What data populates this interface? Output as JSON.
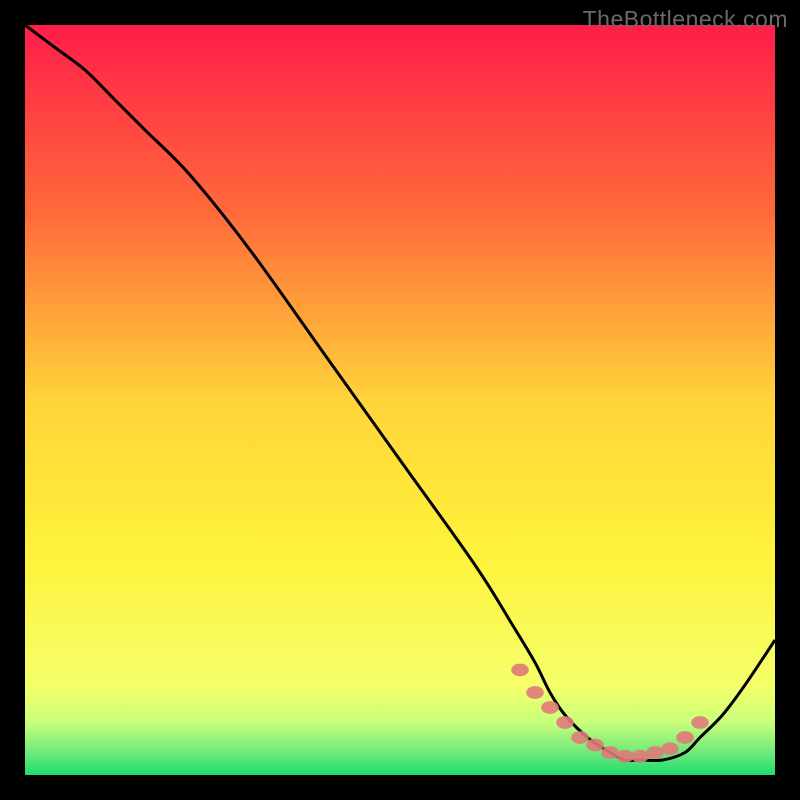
{
  "watermark": "TheBottleneck.com",
  "chart_data": {
    "type": "line",
    "title": "",
    "xlabel": "",
    "ylabel": "",
    "xlim": [
      0,
      100
    ],
    "ylim": [
      0,
      100
    ],
    "background_gradient": {
      "stops": [
        {
          "offset": 0,
          "color": "#ff1d4a"
        },
        {
          "offset": 0.25,
          "color": "#ff6a3a"
        },
        {
          "offset": 0.5,
          "color": "#ffd33a"
        },
        {
          "offset": 0.7,
          "color": "#fff23a"
        },
        {
          "offset": 0.88,
          "color": "#f5ff6a"
        },
        {
          "offset": 0.93,
          "color": "#c8ff7a"
        },
        {
          "offset": 0.97,
          "color": "#6fe97a"
        },
        {
          "offset": 1.0,
          "color": "#1edc6e"
        }
      ]
    },
    "series": [
      {
        "name": "curve",
        "color": "#000000",
        "stroke_width": 3,
        "x": [
          0,
          4,
          8,
          12,
          16,
          22,
          30,
          40,
          50,
          60,
          65,
          68,
          70,
          72,
          75,
          78,
          80,
          82,
          85,
          88,
          90,
          93,
          96,
          100
        ],
        "y": [
          100,
          97,
          94,
          90,
          86,
          80,
          70,
          56,
          42,
          28,
          20,
          15,
          11,
          8,
          5,
          3,
          2,
          2,
          2,
          3,
          5,
          8,
          12,
          18
        ]
      }
    ],
    "markers": {
      "name": "highlight-dots",
      "color": "#e07a7a",
      "radius": 8,
      "x": [
        66,
        68,
        70,
        72,
        74,
        76,
        78,
        80,
        82,
        84,
        86,
        88,
        90
      ],
      "y": [
        14,
        11,
        9,
        7,
        5,
        4,
        3,
        2.5,
        2.5,
        3,
        3.5,
        5,
        7
      ]
    }
  }
}
